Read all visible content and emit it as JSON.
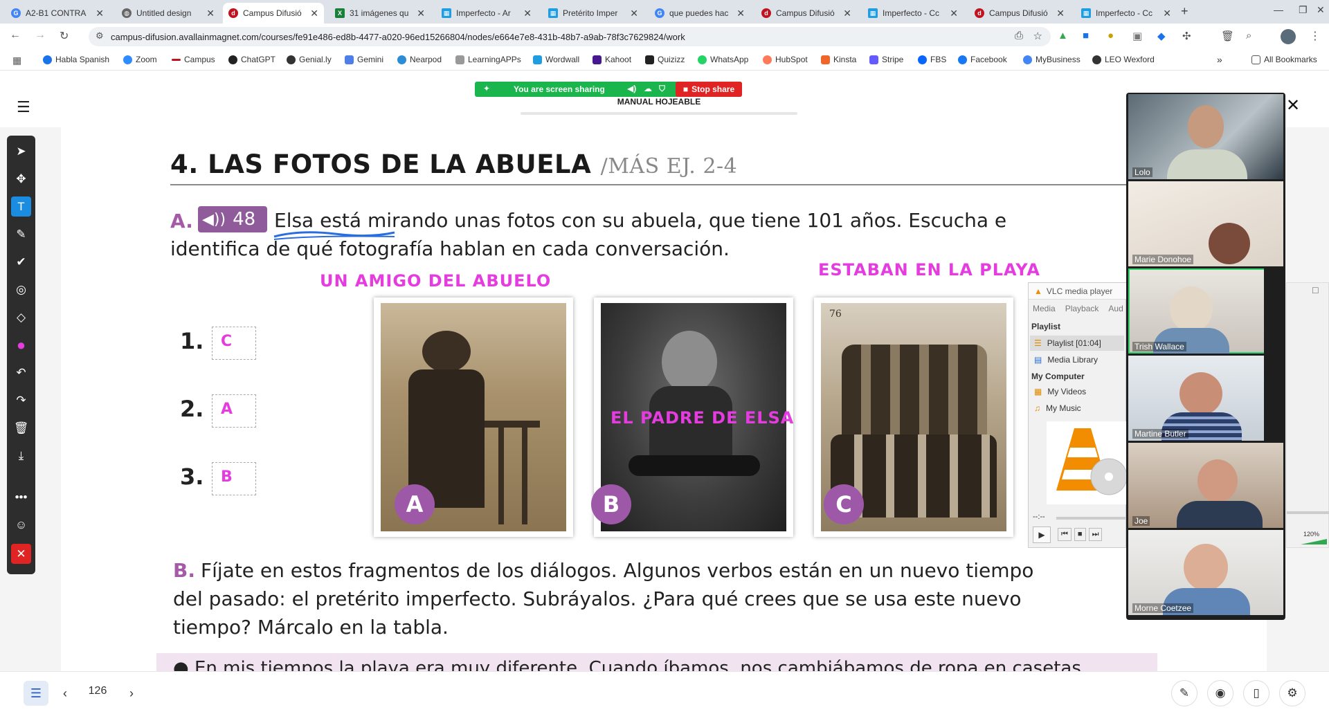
{
  "browser": {
    "tabs": [
      {
        "title": "A2-B1 CONTRA",
        "icon": "google-icon",
        "color": "#4285f4"
      },
      {
        "title": "Untitled design",
        "icon": "globe-icon",
        "color": "#666666"
      },
      {
        "title": "Campus Difusió",
        "icon": "difusion-icon",
        "color": "#c1121f",
        "active": true
      },
      {
        "title": "31 imágenes qu",
        "icon": "x-icon",
        "color": "#1a7f37"
      },
      {
        "title": "Imperfecto - Ar",
        "icon": "grid-icon",
        "color": "#1f9de0"
      },
      {
        "title": "Pretérito Imper",
        "icon": "grid-icon",
        "color": "#1f9de0"
      },
      {
        "title": "que puedes hac",
        "icon": "google-icon",
        "color": "#4285f4"
      },
      {
        "title": "Campus Difusió",
        "icon": "difusion-icon",
        "color": "#c1121f"
      },
      {
        "title": "Imperfecto - Cc",
        "icon": "grid-icon",
        "color": "#1f9de0"
      },
      {
        "title": "Campus Difusió",
        "icon": "difusion-icon",
        "color": "#c1121f"
      },
      {
        "title": "Imperfecto - Cc",
        "icon": "grid-icon",
        "color": "#1f9de0"
      }
    ],
    "url": "campus-difusion.avallainmagnet.com/courses/fe91e486-ed8b-4477-a020-96ed15266804/nodes/e664e7e8-431b-48b7-a9ab-78f3c7629824/work",
    "bookmarks": [
      "Habla Spanish",
      "Zoom",
      "Campus",
      "ChatGPT",
      "Genial.ly",
      "Gemini",
      "Nearpod",
      "LearningAPPs",
      "Wordwall",
      "Kahoot",
      "Quizizz",
      "WhatsApp",
      "HubSpot",
      "Kinsta",
      "Stripe",
      "FBS",
      "Facebook",
      "MyBusiness",
      "LEO Wexford"
    ],
    "all_bookmarks": "All Bookmarks"
  },
  "share": {
    "sharing_text": "You are screen sharing",
    "stop_label": "Stop share"
  },
  "doc": {
    "header_title": "MANUAL HOJEABLE",
    "section_title": "4.  LAS FOTOS DE LA ABUELA",
    "section_more": "/MÁS EJ. 2-4",
    "part_a_letter": "A.",
    "audio_track": "48",
    "part_a_text_line1": "Elsa está mirando unas fotos con su abuela, que tiene 101 años. Escucha e",
    "part_a_text_line2": "identifica de qué fotografía hablan en cada conversación.",
    "annotations": {
      "amigo": "UN AMIGO DEL ABUELO",
      "playa": "ESTABAN EN LA PLAYA",
      "padre": "EL PADRE DE ELSA"
    },
    "numbers": [
      "1.",
      "2.",
      "3."
    ],
    "answers": [
      "C",
      "A",
      "B"
    ],
    "photo_labels": [
      "A",
      "B",
      "C"
    ],
    "photo_c_number": "76",
    "part_b_letter": "B.",
    "part_b_line1": "Fíjate en estos fragmentos de los diálogos. Algunos verbos están en un nuevo tiempo",
    "part_b_line2": "del pasado: el pretérito imperfecto. Subráyalos. ¿Para qué crees que se usa este nuevo",
    "part_b_line3": "tiempo? Márcalo en la tabla.",
    "quote_partial": "● En mis tiempos la playa era muy diferente. Cuando íbamos, nos cambiábamos de ropa en casetas"
  },
  "participants": [
    "Lolo",
    "Marie Donohoe",
    "Trish Wallace",
    "Martine Butler",
    "Joe",
    "Morne Coetzee"
  ],
  "vlc": {
    "title": "VLC media player",
    "menu": [
      "Media",
      "Playback",
      "Aud"
    ],
    "playlist_header": "Playlist",
    "playlist_item": "Playlist [01:04]",
    "media_library": "Media Library",
    "my_computer": "My Computer",
    "my_videos": "My Videos",
    "my_music": "My Music",
    "time": "--:--",
    "volume": "120%"
  },
  "bottom": {
    "page_number": "126"
  },
  "colors": {
    "accent_pink": "#e53ce0",
    "badge_purple": "#9d59a8",
    "share_green": "#1ab54c",
    "stop_red": "#e02424"
  }
}
